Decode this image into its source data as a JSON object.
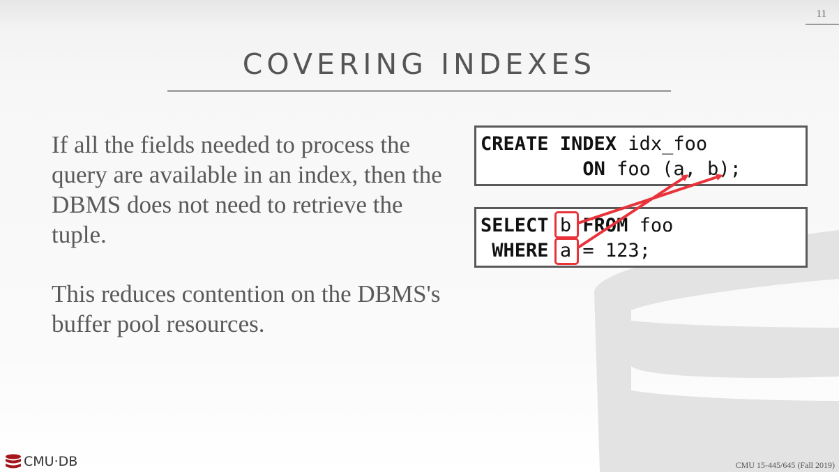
{
  "slide": {
    "page_number": "11",
    "title": "COVERING INDEXES",
    "paragraphs": [
      "If all the fields needed to process the query are available in an index, then the DBMS does not need to retrieve the tuple.",
      "This reduces contention on the DBMS's buffer pool resources."
    ]
  },
  "code": {
    "create_index": {
      "kw1": "CREATE INDEX",
      "name": " idx_foo",
      "indent": "         ",
      "kw2": "ON",
      "rest": " foo (a, b);"
    },
    "select": {
      "kw1": "SELECT",
      "col": "b",
      "kw2": "FROM",
      "table": " foo",
      "kw3": "WHERE",
      "col2": "a",
      "rest": " = 123;"
    }
  },
  "branding": {
    "logo_text": "CMU·DB",
    "footer_text": "CMU 15-445/645 (Fall 2019)",
    "highlight_color": "#e8333b",
    "watermark_color": "#e3e3e3"
  }
}
